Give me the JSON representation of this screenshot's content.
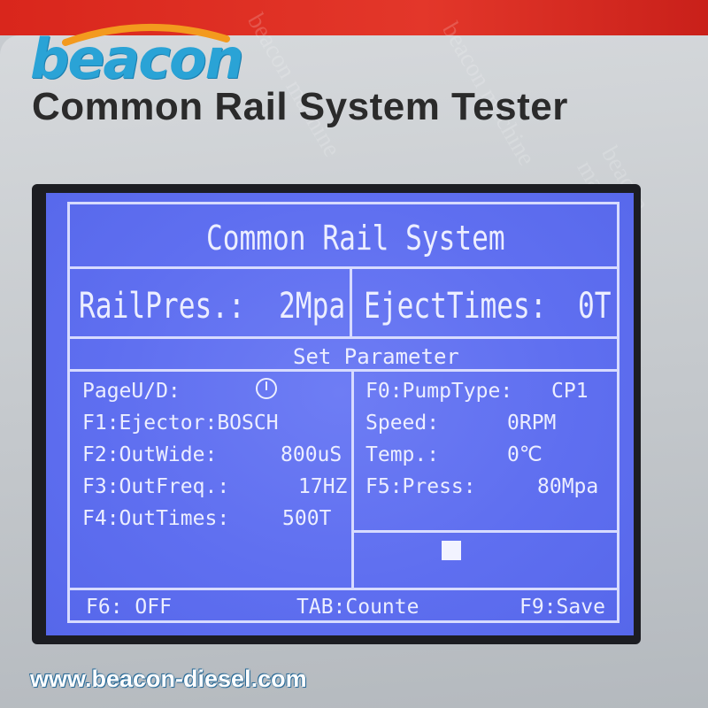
{
  "brand": {
    "logo_text": "beacon",
    "headline": "Common Rail System Tester",
    "website": "www.beacon-diesel.com"
  },
  "screen": {
    "title": "Common Rail System",
    "rail_pres_label": "RailPres.:",
    "rail_pres_value": "2Mpa",
    "eject_times_label": "EjectTimes:",
    "eject_times_value": "0T",
    "section_title": "Set Parameter",
    "left": {
      "page_ud_label": "PageU/D:",
      "f1": "F1:Ejector:BOSCH",
      "f2_label": "F2:OutWide:",
      "f2_value": "800uS",
      "f3_label": "F3:OutFreq.:",
      "f3_value": "17HZ",
      "f4_label": "F4:OutTimes:",
      "f4_value": "500T"
    },
    "right": {
      "f0_label": "F0:PumpType:",
      "f0_value": "CP1",
      "speed_label": "Speed:",
      "speed_value": "0RPM",
      "temp_label": "Temp.:",
      "temp_value": "0℃",
      "f5_label": "F5:Press:",
      "f5_value": "80Mpa"
    },
    "footer": {
      "f6": "F6: OFF",
      "tab": "TAB:Counte",
      "f9": "F9:Save"
    }
  },
  "colors": {
    "lcd_bg": "#5f6ff0",
    "lcd_text": "#eceeff",
    "logo_blue": "#2aa3d6",
    "accent_red": "#d9261c"
  },
  "icons": {
    "page_indicator": "power-icon",
    "logo_swoosh": "swoosh-icon"
  },
  "watermark_text": "beacon machine"
}
